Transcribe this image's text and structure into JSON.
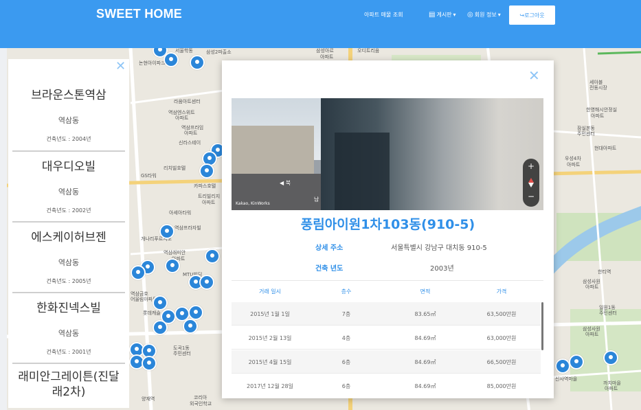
{
  "header": {
    "brand": "SWEET HOME",
    "nav": {
      "apt_search": "아파트 매물 조회",
      "board": "게시판",
      "member_info": "회원 정보",
      "logout": "로그아웃"
    }
  },
  "map": {
    "labels": [
      "서울학동",
      "삼성2파출소",
      "논현아이파크",
      "삼성아르",
      "아파트",
      "오디트리움",
      "라움아트센터",
      "역삼엔스위트",
      "아파트",
      "역삼프라임",
      "아파트",
      "신라스테이",
      "리치빌호텔",
      "GS타워",
      "카파스호텔",
      "트리빌리지",
      "아파트",
      "아세아타워",
      "역삼프라자빌",
      "개나리푸르지오",
      "역삼래미안",
      "아파트",
      "MTU빌딩",
      "역삼금호",
      "어울림아파트",
      "롯데캐슬",
      "삼성사원",
      "아파트",
      "한영해시안정실",
      "아파트",
      "세아블",
      "전동시장",
      "잠실본동",
      "주민센터",
      "현대아파트",
      "우성4차",
      "아파트",
      "일원1동",
      "주민센터",
      "삼성사원",
      "아파트",
      "까치마을",
      "아파트",
      "도곡1동",
      "주민센터",
      "양재역",
      "코리아",
      "외국인학교",
      "신사역마을",
      "한티역"
    ]
  },
  "list": {
    "items": [
      {
        "name": "브라운스톤역삼",
        "dong": "역삼동",
        "year": "건축년도 : 2004년"
      },
      {
        "name": "대우디오빌",
        "dong": "역삼동",
        "year": "건축년도 : 2002년"
      },
      {
        "name": "에스케이허브젠",
        "dong": "역삼동",
        "year": "건축년도 : 2005년"
      },
      {
        "name": "한화진넥스빌",
        "dong": "역삼동",
        "year": "건축년도 : 2001년"
      },
      {
        "name": "래미안그레이튼(진달래2차)",
        "dong": "",
        "year": ""
      }
    ]
  },
  "modal": {
    "title": "풍림아이원1차103동(910-5)",
    "address_label": "상세 주소",
    "address_value": "서울특별시 강남구 대치동 910-5",
    "year_label": "건축 년도",
    "year_value": "2003년",
    "roadview_credit": "Kakao, KinWorks",
    "roadview_north": "북",
    "roadview_south": "남",
    "table": {
      "headers": [
        "거래 일시",
        "층수",
        "면적",
        "가격"
      ],
      "rows": [
        [
          "2015년 1월 1일",
          "7층",
          "83.65㎡",
          "63,500만원"
        ],
        [
          "2015년 2월 13일",
          "4층",
          "84.69㎡",
          "63,000만원"
        ],
        [
          "2015년 4월 15일",
          "6층",
          "84.69㎡",
          "66,500만원"
        ],
        [
          "2017년 12월 28일",
          "6층",
          "84.69㎡",
          "85,000만원"
        ]
      ]
    }
  }
}
